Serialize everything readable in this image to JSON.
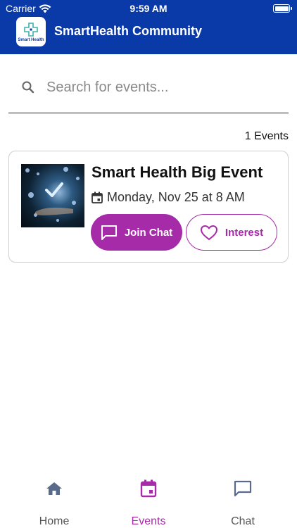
{
  "status_bar": {
    "carrier": "Carrier",
    "time": "9:59 AM"
  },
  "app_bar": {
    "title": "SmartHealth Community",
    "logo_text": "Smart Health"
  },
  "search": {
    "placeholder": "Search for events..."
  },
  "events_count": "1 Events",
  "events": [
    {
      "title": "Smart Health Big Event",
      "date": "Monday, Nov 25 at 8 AM",
      "join_label": "Join Chat",
      "interest_label": "Interest"
    }
  ],
  "nav": {
    "tabs": [
      {
        "label": "Home",
        "icon": "home-icon"
      },
      {
        "label": "Events",
        "icon": "calendar-icon",
        "active": true
      },
      {
        "label": "Chat",
        "icon": "chat-icon"
      }
    ]
  },
  "colors": {
    "brand_blue": "#0a3aa8",
    "accent_purple": "#a62ba8"
  }
}
